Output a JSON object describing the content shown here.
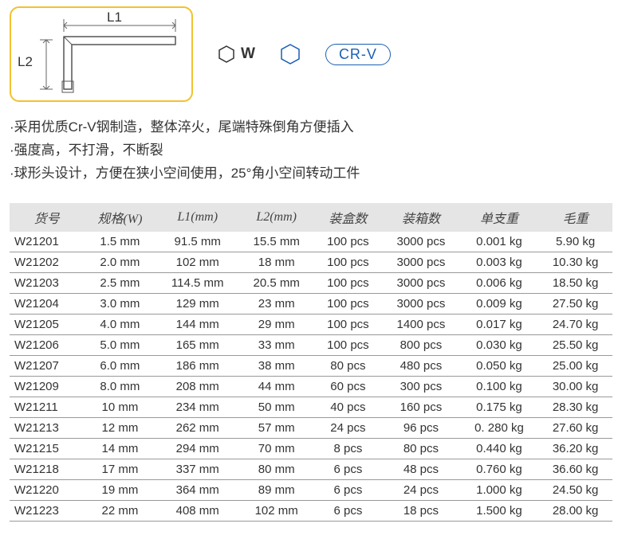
{
  "diagram": {
    "l1_label": "L1",
    "l2_label": "L2",
    "w_label": "W"
  },
  "badge": "CR-V",
  "bullets": [
    "采用优质Cr-V钢制造，整体淬火，尾端特殊倒角方便插入",
    "强度高，不打滑，不断裂",
    "球形头设计，方便在狭小空间使用，25°角小空间转动工件"
  ],
  "headers": [
    "货号",
    "规格(W)",
    "L1(mm)",
    "L2(mm)",
    "装盒数",
    "装箱数",
    "单支重",
    "毛重"
  ],
  "chart_data": {
    "type": "table",
    "columns": [
      "货号",
      "规格(W)",
      "L1(mm)",
      "L2(mm)",
      "装盒数",
      "装箱数",
      "单支重",
      "毛重"
    ],
    "rows": [
      [
        "W21201",
        "1.5 mm",
        "91.5 mm",
        "15.5 mm",
        "100 pcs",
        "3000 pcs",
        "0.001 kg",
        "5.90 kg"
      ],
      [
        "W21202",
        "2.0 mm",
        "102 mm",
        "18 mm",
        "100 pcs",
        "3000 pcs",
        "0.003 kg",
        "10.30 kg"
      ],
      [
        "W21203",
        "2.5 mm",
        "114.5 mm",
        "20.5 mm",
        "100 pcs",
        "3000 pcs",
        "0.006 kg",
        "18.50 kg"
      ],
      [
        "W21204",
        "3.0 mm",
        "129 mm",
        "23 mm",
        "100 pcs",
        "3000 pcs",
        "0.009 kg",
        "27.50 kg"
      ],
      [
        "W21205",
        "4.0 mm",
        "144 mm",
        "29 mm",
        "100 pcs",
        "1400 pcs",
        "0.017 kg",
        "24.70 kg"
      ],
      [
        "W21206",
        "5.0 mm",
        "165 mm",
        "33 mm",
        "100 pcs",
        "800 pcs",
        "0.030 kg",
        "25.50 kg"
      ],
      [
        "W21207",
        "6.0 mm",
        "186 mm",
        "38 mm",
        "80 pcs",
        "480 pcs",
        "0.050 kg",
        "25.00 kg"
      ],
      [
        "W21209",
        "8.0 mm",
        "208 mm",
        "44 mm",
        "60 pcs",
        "300 pcs",
        "0.100 kg",
        "30.00 kg"
      ],
      [
        "W21211",
        "10 mm",
        "234 mm",
        "50 mm",
        "40 pcs",
        "160 pcs",
        "0.175 kg",
        "28.30 kg"
      ],
      [
        "W21213",
        "12 mm",
        "262 mm",
        "57 mm",
        "24 pcs",
        "96 pcs",
        "0. 280 kg",
        "27.60 kg"
      ],
      [
        "W21215",
        "14 mm",
        "294 mm",
        "70 mm",
        "8 pcs",
        "80 pcs",
        "0.440 kg",
        "36.20 kg"
      ],
      [
        "W21218",
        "17 mm",
        "337 mm",
        "80 mm",
        "6 pcs",
        "48 pcs",
        "0.760 kg",
        "36.60 kg"
      ],
      [
        "W21220",
        "19 mm",
        "364 mm",
        "89 mm",
        "6 pcs",
        "24 pcs",
        "1.000 kg",
        "24.50 kg"
      ],
      [
        "W21223",
        "22 mm",
        "408 mm",
        "102 mm",
        "6 pcs",
        "18 pcs",
        "1.500 kg",
        "28.00 kg"
      ]
    ]
  }
}
